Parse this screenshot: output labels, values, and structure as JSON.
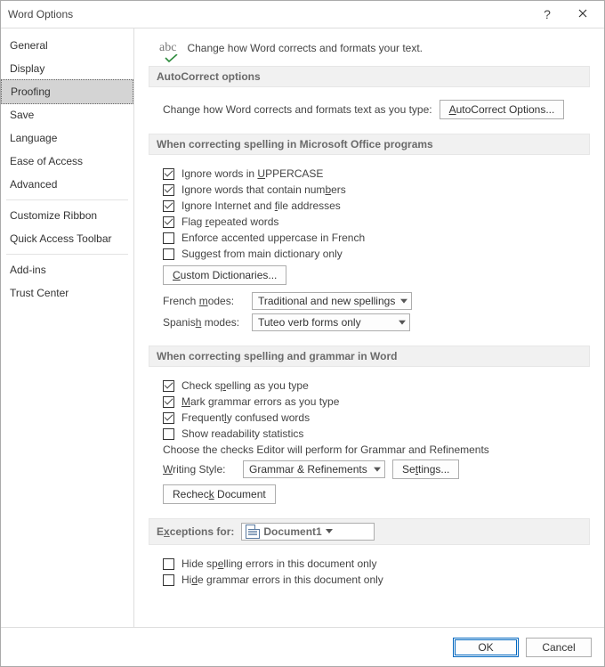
{
  "title": "Word Options",
  "sidebar": {
    "items": [
      {
        "label": "General",
        "selected": false
      },
      {
        "label": "Display",
        "selected": false
      },
      {
        "label": "Proofing",
        "selected": true
      },
      {
        "label": "Save",
        "selected": false
      },
      {
        "label": "Language",
        "selected": false
      },
      {
        "label": "Ease of Access",
        "selected": false
      },
      {
        "label": "Advanced",
        "selected": false
      },
      {
        "label": "Customize Ribbon",
        "selected": false
      },
      {
        "label": "Quick Access Toolbar",
        "selected": false
      },
      {
        "label": "Add-ins",
        "selected": false
      },
      {
        "label": "Trust Center",
        "selected": false
      }
    ]
  },
  "intro": "Change how Word corrects and formats your text.",
  "sections": {
    "autocorrect": {
      "header": "AutoCorrect options",
      "text": "Change how Word corrects and formats text as you type:",
      "button": "AutoCorrect Options..."
    },
    "office_spelling": {
      "header": "When correcting spelling in Microsoft Office programs",
      "chk_uppercase": "Ignore words in UPPERCASE",
      "chk_numbers": "Ignore words that contain numbers",
      "chk_internet": "Ignore Internet and file addresses",
      "chk_repeated": "Flag repeated words",
      "chk_french_accent": "Enforce accented uppercase in French",
      "chk_main_dict": "Suggest from main dictionary only",
      "custom_dict_btn": "Custom Dictionaries...",
      "french_label": "French modes:",
      "french_value": "Traditional and new spellings",
      "spanish_label": "Spanish modes:",
      "spanish_value": "Tuteo verb forms only"
    },
    "word_grammar": {
      "header": "When correcting spelling and grammar in Word",
      "chk_spelling_type": "Check spelling as you type",
      "chk_grammar_type": "Mark grammar errors as you type",
      "chk_confused": "Frequently confused words",
      "chk_readability": "Show readability statistics",
      "choose_checks": "Choose the checks Editor will perform for Grammar and Refinements",
      "writing_style_label": "Writing Style:",
      "writing_style_value": "Grammar & Refinements",
      "settings_btn": "Settings...",
      "recheck_btn": "Recheck Document"
    },
    "exceptions": {
      "header_label": "Exceptions for:",
      "doc_value": "Document1",
      "chk_hide_spelling": "Hide spelling errors in this document only",
      "chk_hide_grammar": "Hide grammar errors in this document only"
    }
  },
  "footer": {
    "ok": "OK",
    "cancel": "Cancel"
  }
}
